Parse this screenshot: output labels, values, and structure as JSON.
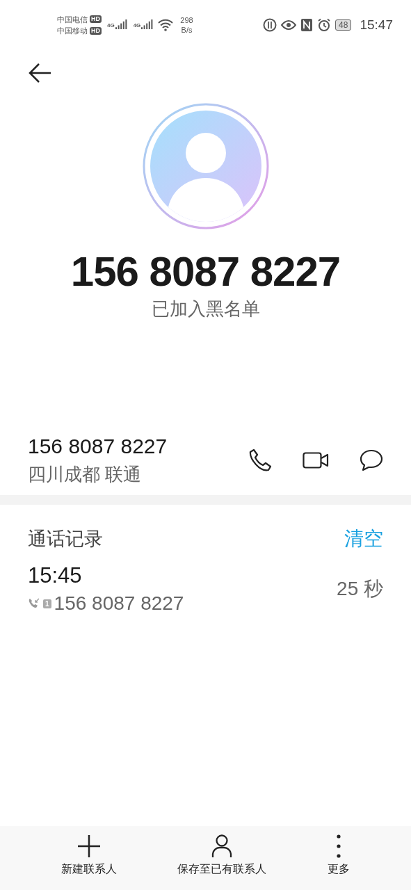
{
  "status_bar": {
    "carriers": [
      {
        "name": "中国电信",
        "badge": "HD",
        "network": "4G"
      },
      {
        "name": "中国移动",
        "badge": "HD",
        "network": "4G"
      }
    ],
    "speed": "298",
    "speed_unit": "B/s",
    "battery": "48",
    "time": "15:47"
  },
  "header": {
    "number": "156 8087 8227",
    "status": "已加入黑名单"
  },
  "contact": {
    "number": "156 8087 8227",
    "location": "四川成都 联通"
  },
  "call_log": {
    "title": "通话记录",
    "clear": "清空",
    "entries": [
      {
        "time": "15:45",
        "sim": "1",
        "number": "156 8087 8227",
        "duration": "25 秒"
      }
    ]
  },
  "actions": [
    {
      "kind": "add",
      "label": "新建联系人"
    },
    {
      "kind": "person",
      "label": "保存至已有联系人"
    },
    {
      "kind": "more",
      "label": "更多"
    }
  ]
}
